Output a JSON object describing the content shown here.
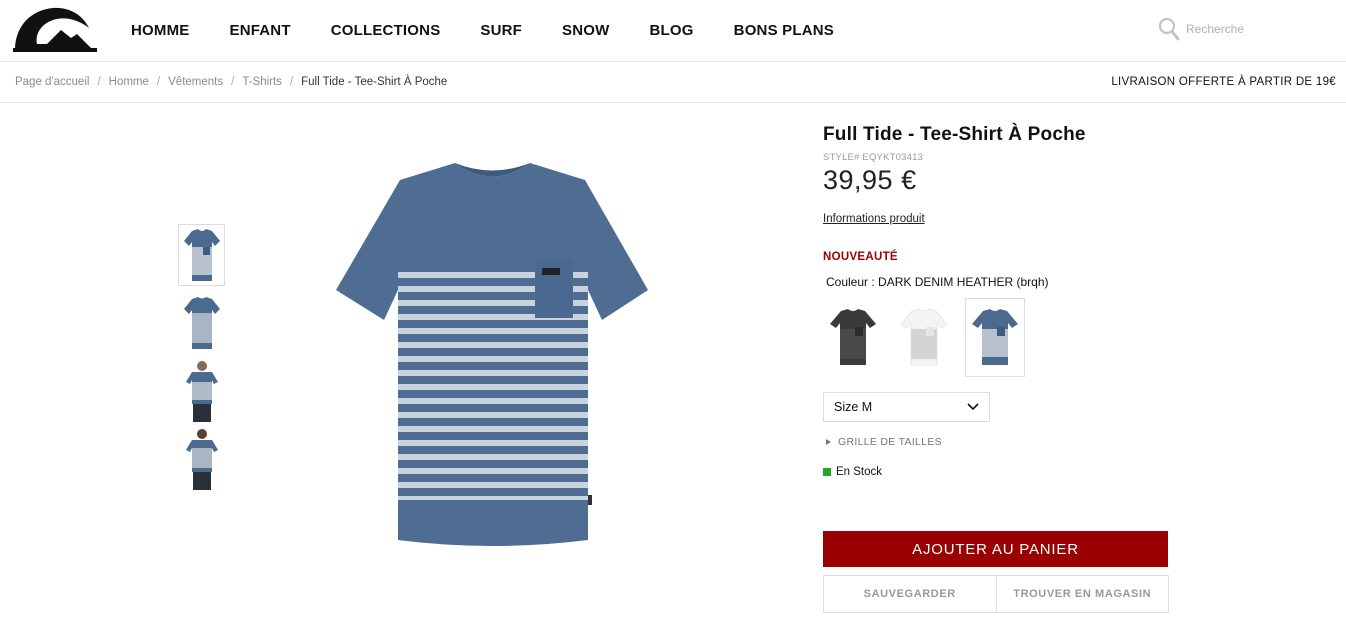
{
  "header": {
    "logo": "quiksilver-logo",
    "nav": [
      {
        "label": "HOMME"
      },
      {
        "label": "ENFANT"
      },
      {
        "label": "COLLECTIONS"
      },
      {
        "label": "SURF"
      },
      {
        "label": "SNOW"
      },
      {
        "label": "BLOG"
      },
      {
        "label": "BONS PLANS"
      }
    ],
    "search": {
      "placeholder": "Recherche",
      "icon": "search-icon"
    }
  },
  "breadcrumb": {
    "items": [
      "Page d'accueil",
      "Homme",
      "Vêtements",
      "T-Shirts"
    ],
    "current": "Full Tide - Tee-Shirt À Poche",
    "separator": "/"
  },
  "shipping_notice": "LIVRAISON OFFERTE À PARTIR DE 19€",
  "product": {
    "title": "Full Tide - Tee-Shirt À Poche",
    "style": "STYLE# EQYKT03413",
    "price": "39,95 €",
    "info_link": "Informations produit",
    "badge": "NOUVEAUTÉ",
    "color_label": "Couleur : DARK DENIM HEATHER (brqh)",
    "size": "Size M",
    "size_chart": "GRILLE DE TAILLES",
    "stock": "En Stock",
    "add_to_cart": "AJOUTER AU PANIER",
    "save": "SAUVEGARDER",
    "find_store": "TROUVER EN MAGASIN"
  },
  "colors": {
    "brand_red": "#9a0000",
    "stock_green": "#1fa81f",
    "denim": "#4a6a90"
  }
}
